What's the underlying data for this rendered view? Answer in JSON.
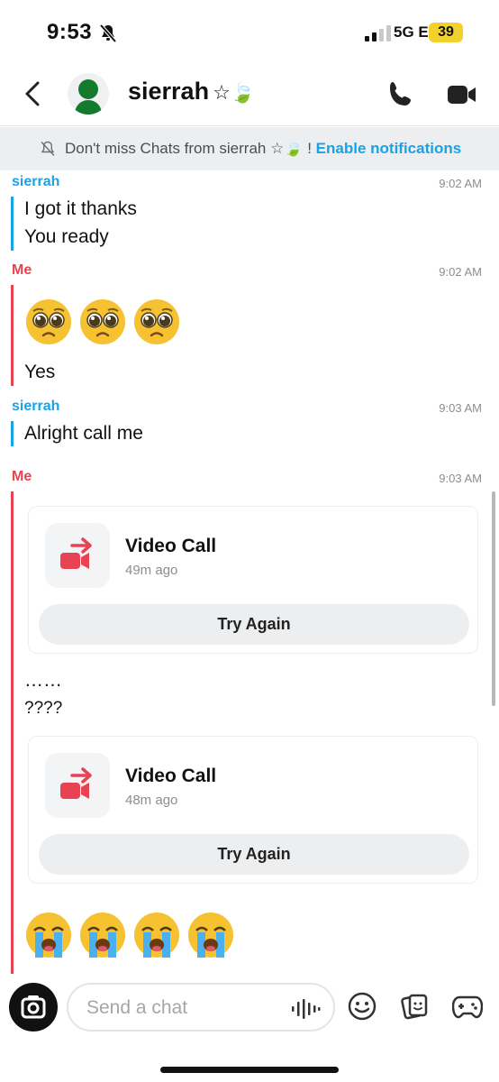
{
  "status_bar": {
    "time": "9:53",
    "network": "5G E",
    "battery": "39"
  },
  "header": {
    "name": "sierrah",
    "name_decoration": "☆🍃"
  },
  "banner": {
    "prefix": "Don't miss Chats from sierrah ☆🍃 !",
    "link": "Enable notifications"
  },
  "messages": [
    {
      "sender": "sierrah",
      "time": "9:02 AM",
      "lines": [
        "I got it thanks",
        "You ready"
      ]
    },
    {
      "sender": "Me",
      "time": "9:02 AM",
      "emoji": "pleading-face x3",
      "lines": [
        "Yes"
      ]
    },
    {
      "sender": "sierrah",
      "time": "9:03 AM",
      "lines": [
        "Alright call me"
      ]
    },
    {
      "sender": "Me",
      "time": "9:03 AM",
      "lines": [
        "……",
        "????"
      ]
    }
  ],
  "calls": [
    {
      "title": "Video Call",
      "ago": "49m ago",
      "button": "Try Again"
    },
    {
      "title": "Video Call",
      "ago": "48m ago",
      "button": "Try Again"
    }
  ],
  "final_emoji": "loudly-crying-face x4",
  "composer": {
    "placeholder": "Send a chat"
  },
  "colors": {
    "them": "#1aa2e6",
    "me": "#e84352",
    "accent_link": "#1aa2e6",
    "call_red": "#e84352"
  }
}
